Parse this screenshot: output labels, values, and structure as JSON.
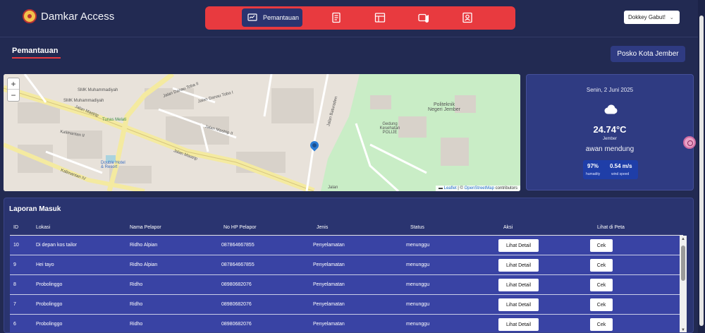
{
  "header": {
    "brand": "Damkar Access",
    "nav": [
      {
        "label": "Pemantauan",
        "icon": "monitor-chart-icon",
        "active": true
      },
      {
        "label": "",
        "icon": "document-icon"
      },
      {
        "label": "",
        "icon": "table-icon"
      },
      {
        "label": "",
        "icon": "video-add-icon"
      },
      {
        "label": "",
        "icon": "profile-card-icon"
      }
    ],
    "user": "Dokkey Gabut!"
  },
  "page": {
    "title": "Pemantauan",
    "posko_button": "Posko Kota Jember"
  },
  "map": {
    "zoom_in": "+",
    "zoom_out": "−",
    "attribution_leaflet": "Leaflet",
    "attribution_osm": "OpenStreetMap",
    "attribution_tail": "contributors",
    "labels": {
      "jalan_mastrip_1": "Jalan Mastrip",
      "jalan_mastrip_2": "Jalan Mastrip",
      "jalan_mastrip_ii": "Jalan Mastrip II",
      "danau_toba_ii": "Jalan Danau Toba II",
      "danau_toba_i": "Jalan Danau Toba I",
      "kalimantan_ii": "Kalimantan II",
      "kalimantan_iv": "Kalimantan IV",
      "batu_raden": "Jalan Baturaden",
      "politeknik": "Politeknik Negeri Jember",
      "gedung": "Gedung Kesehatan POLIJE",
      "smk1": "SMK Muhammadiyah",
      "smk2": "SMK Muhammadiyah",
      "tunas": "Tunas Melati",
      "hotel": "Double Hotel & Resort",
      "jalan_sm": "Jalan"
    }
  },
  "weather": {
    "date": "Senin, 2 Juni 2025",
    "icon": "cloud-icon",
    "temperature": "24.74°C",
    "city": "Jember",
    "description": "awan mendung",
    "humidity": "97%",
    "humidity_label": "humadity",
    "wind": "0.54 m/s",
    "wind_label": "wind speed"
  },
  "reports": {
    "title": "Laporan Masuk",
    "columns": [
      "ID",
      "Lokasi",
      "Nama Pelapor",
      "No HP Pelapor",
      "Jenis",
      "Status",
      "Aksi",
      "Lihat di Peta"
    ],
    "detail_label": "Lihat Detail",
    "cek_label": "Cek",
    "rows": [
      {
        "id": "10",
        "lokasi": "Di depan kos tailor",
        "nama": "Ridho Alpian",
        "hp": "087864667855",
        "jenis": "Penyelamatan",
        "status": "menunggu"
      },
      {
        "id": "9",
        "lokasi": "Hei tayo",
        "nama": "Ridho Alpian",
        "hp": "087864667855",
        "jenis": "Penyelamatan",
        "status": "menunggu"
      },
      {
        "id": "8",
        "lokasi": "Probolinggo",
        "nama": "Ridho",
        "hp": "08980682076",
        "jenis": "Penyelamatan",
        "status": "menunggu"
      },
      {
        "id": "7",
        "lokasi": "Probolinggo",
        "nama": "Ridho",
        "hp": "08980682076",
        "jenis": "Penyelamatan",
        "status": "menunggu"
      },
      {
        "id": "6",
        "lokasi": "Probolinggo",
        "nama": "Ridho",
        "hp": "08980682076",
        "jenis": "Penyelamatan",
        "status": "menunggu"
      }
    ]
  }
}
